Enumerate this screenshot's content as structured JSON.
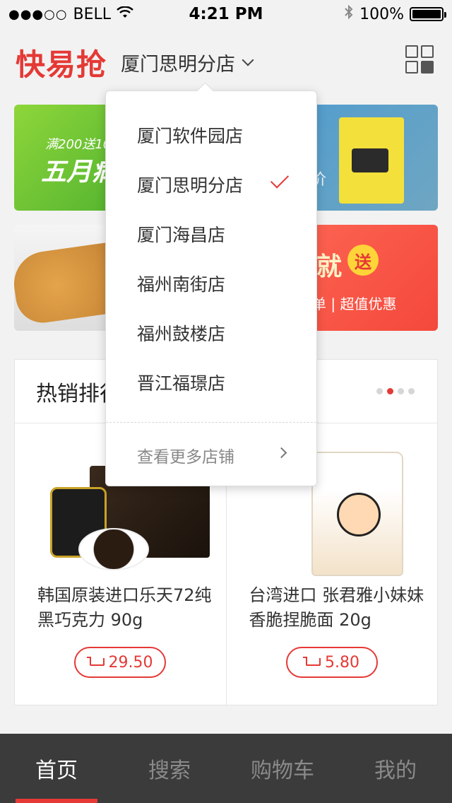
{
  "status_bar": {
    "signal": "●●●○○",
    "carrier": "BELL",
    "time": "4:21 PM",
    "battery": "100%",
    "battery_level": 1.0
  },
  "header": {
    "logo": "快易抢",
    "current_store": "厦门思明分店"
  },
  "banners": {
    "promo_sub": "满200送10",
    "promo_main": "五月病",
    "price_text": "价",
    "delivery_big": "就",
    "delivery_badge": "送",
    "delivery_small": "单 | 超值优惠"
  },
  "hot_section": {
    "title": "热销排行",
    "pager": {
      "count": 4,
      "active_index": 1
    },
    "products": [
      {
        "name": "韩国原装进口乐天72纯黑巧克力 90g",
        "price": "29.50"
      },
      {
        "name": "台湾进口 张君雅小妹妹香脆捏脆面 20g",
        "price": "5.80"
      }
    ]
  },
  "dropdown": {
    "stores": [
      {
        "label": "厦门软件园店",
        "selected": false
      },
      {
        "label": "厦门思明分店",
        "selected": true
      },
      {
        "label": "厦门海昌店",
        "selected": false
      },
      {
        "label": "福州南街店",
        "selected": false
      },
      {
        "label": "福州鼓楼店",
        "selected": false
      },
      {
        "label": "晋江福璟店",
        "selected": false
      }
    ],
    "more_label": "查看更多店铺"
  },
  "tabbar": {
    "tabs": [
      {
        "label": "首页",
        "active": true
      },
      {
        "label": "搜索",
        "active": false
      },
      {
        "label": "购物车",
        "active": false
      },
      {
        "label": "我的",
        "active": false
      }
    ]
  },
  "colors": {
    "accent": "#e53935",
    "tabbar_bg": "#3b3b3b",
    "page_bg": "#f2f2f2"
  },
  "icons": [
    "wifi-icon",
    "bluetooth-icon",
    "battery-icon",
    "chevron-down-icon",
    "grid-menu-icon",
    "cart-icon",
    "check-icon",
    "chevron-right-icon"
  ]
}
